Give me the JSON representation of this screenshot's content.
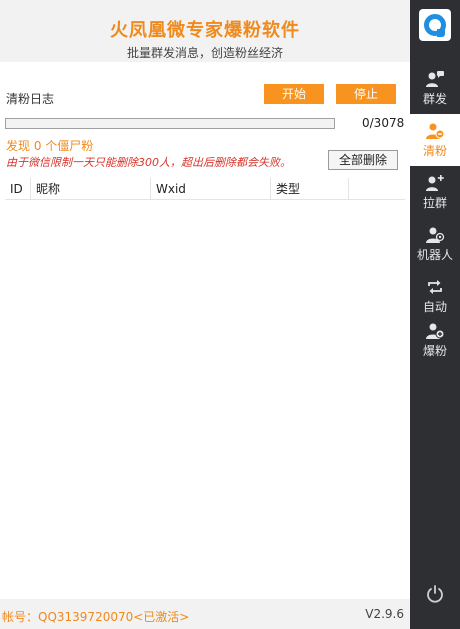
{
  "header": {
    "title": "火凤凰微专家爆粉软件",
    "subtitle": "批量群发消息，创造粉丝经济"
  },
  "log": {
    "label": "清粉日志",
    "start_label": "开始",
    "stop_label": "停止"
  },
  "progress": {
    "count_text": "0/3078",
    "fraction": 0
  },
  "found_text": "发现 0 个僵尸粉",
  "warning_text": "由于微信限制一天只能删除300人，超出后删除都会失败。",
  "delete_all_label": "全部删除",
  "table": {
    "columns": [
      "ID",
      "昵称",
      "Wxid",
      "类型",
      ""
    ],
    "rows": []
  },
  "footer": {
    "account": "帐号：QQ3139720070<已激活>",
    "version": "V2.9.6"
  },
  "sidebar": {
    "items": [
      {
        "label": "群发",
        "icon": "user-chat-icon"
      },
      {
        "label": "清粉",
        "icon": "user-remove-icon",
        "active": true
      },
      {
        "label": "拉群",
        "icon": "user-add-icon"
      },
      {
        "label": "机器人",
        "icon": "user-robot-icon"
      },
      {
        "label": "自动",
        "icon": "repeat-icon"
      },
      {
        "label": "爆粉",
        "icon": "user-plus-icon"
      }
    ],
    "power_icon": "power-icon"
  },
  "colors": {
    "accent": "#f7931e",
    "title": "#f08a1c",
    "warning": "#d9342b",
    "sidebar_bg": "#2d2f33",
    "logo_blue": "#1e8fe1"
  }
}
